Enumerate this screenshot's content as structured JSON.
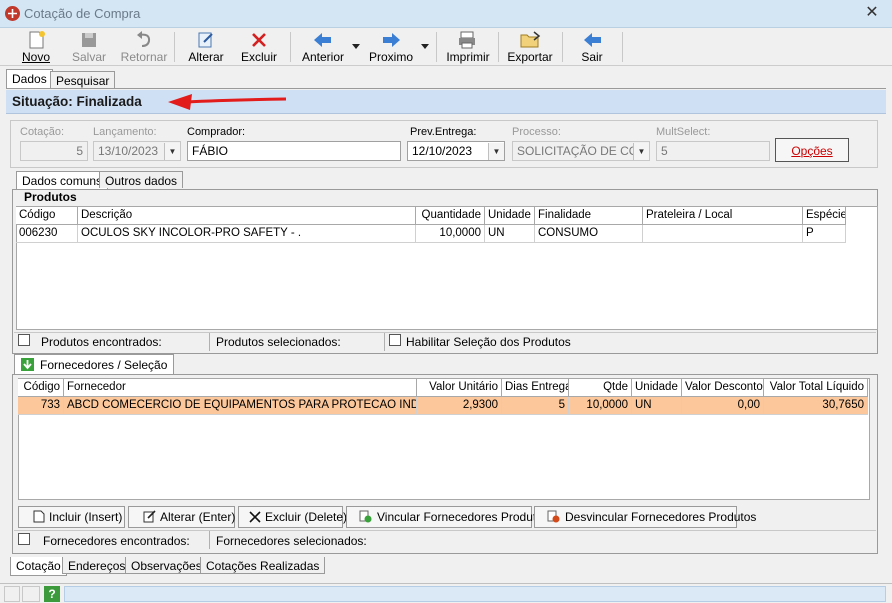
{
  "window": {
    "title": "Cotação de Compra",
    "close": "✕"
  },
  "toolbar": {
    "novo": "Novo",
    "salvar": "Salvar",
    "retornar": "Retornar",
    "alterar": "Alterar",
    "excluir": "Excluir",
    "anterior": "Anterior",
    "proximo": "Proximo",
    "imprimir": "Imprimir",
    "exportar": "Exportar",
    "sair": "Sair"
  },
  "top_tabs": [
    "Dados",
    "Pesquisar"
  ],
  "situacao": "Situação: Finalizada",
  "fields": {
    "cotacao_label": "Cotação:",
    "cotacao_value": "5",
    "lancamento_label": "Lançamento:",
    "lancamento_value": "13/10/2023",
    "comprador_label": "Comprador:",
    "comprador_value": "FÁBIO",
    "preventrega_label": "Prev.Entrega:",
    "preventrega_value": "12/10/2023",
    "processo_label": "Processo:",
    "processo_value": "SOLICITAÇÃO DE COM",
    "multselect_label": "MultSelect:",
    "multselect_value": "5",
    "opcoes_label": "Opções"
  },
  "sub_tabs": [
    "Dados comuns",
    "Outros dados"
  ],
  "produtos": {
    "group_label": "Produtos",
    "columns": [
      "Código",
      "Descrição",
      "Quantidade",
      "Unidade",
      "Finalidade",
      "Prateleira / Local",
      "Espécie"
    ],
    "rows": [
      [
        "006230",
        "OCULOS SKY INCOLOR-PRO SAFETY - .",
        "10,0000",
        "UN",
        "CONSUMO",
        "",
        "P"
      ]
    ],
    "found_label": "Produtos encontrados:",
    "selected_label": "Produtos selecionados:",
    "enable_label": "Habilitar Seleção dos Produtos"
  },
  "fornecedores": {
    "tab_label": "Fornecedores / Seleção",
    "columns": [
      "Código",
      "Fornecedor",
      "Valor Unitário",
      "Dias Entrega",
      "Qtde",
      "Unidade",
      "Valor Desconto",
      "Valor Total Líquido"
    ],
    "rows": [
      [
        "733",
        "ABCD COMECERCIO DE EQUIPAMENTOS PARA PROTECAO INDIVIDU",
        "2,9300",
        "5",
        "10,0000",
        "UN",
        "0,00",
        "30,7650"
      ]
    ],
    "buttons": {
      "incluir": "Incluir (Insert)",
      "alterar": "Alterar (Enter)",
      "excluir": "Excluir (Delete)",
      "vincular": "Vincular Fornecedores Produtos",
      "desvincular": "Desvincular Fornecedores Produtos"
    },
    "found_label": "Fornecedores encontrados:",
    "selected_label": "Fornecedores selecionados:"
  },
  "bottom_tabs": [
    "Cotação",
    "Endereços",
    "Observações",
    "Cotações Realizadas"
  ],
  "status": {
    "help": "?"
  }
}
